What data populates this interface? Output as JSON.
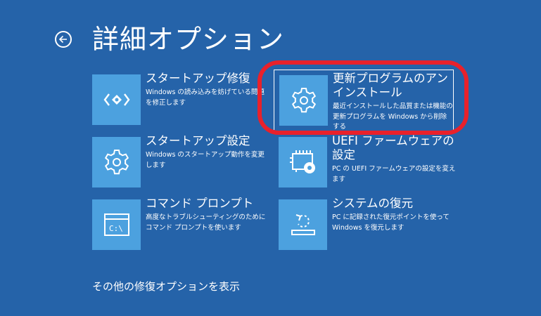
{
  "header": {
    "title": "詳細オプション",
    "back_icon": "arrow-left-circle-icon"
  },
  "options": [
    {
      "id": "startup-repair",
      "title": "スタートアップ修復",
      "description": "Windows の読み込みを妨げている問題を修正します",
      "icon": "code-diamond-icon"
    },
    {
      "id": "uninstall-updates",
      "title": "更新プログラムのアンインストール",
      "description": "最近インストールした品質または機能の更新プログラムを Windows から削除する",
      "icon": "gear-icon",
      "selected": true
    },
    {
      "id": "startup-settings",
      "title": "スタートアップ設定",
      "description": "Windows のスタートアップ動作を変更します",
      "icon": "gear-icon"
    },
    {
      "id": "uefi-firmware",
      "title": "UEFI ファームウェアの設定",
      "description": "PC の UEFI ファームウェアの設定を変えます",
      "icon": "chip-gear-icon"
    },
    {
      "id": "command-prompt",
      "title": "コマンド プロンプト",
      "description": "高度なトラブルシューティングのためにコマンド プロンプトを使います",
      "icon": "terminal-icon"
    },
    {
      "id": "system-restore",
      "title": "システムの復元",
      "description": "PC に記録された復元ポイントを使って Windows を復元します",
      "icon": "restore-icon"
    }
  ],
  "more_options_label": "その他の修復オプションを表示",
  "colors": {
    "background": "#2563a9",
    "tile": "#4ca1df",
    "highlight": "#e8212b"
  }
}
